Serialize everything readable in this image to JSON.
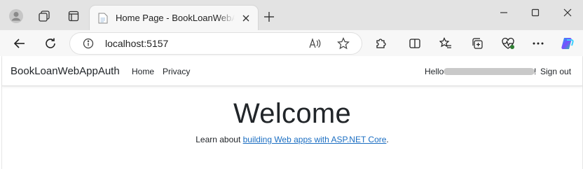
{
  "browser": {
    "tab": {
      "title": "Home Page - BookLoanWebAppAuth"
    },
    "address": {
      "url_host": "localhost",
      "url_port": ":5157"
    },
    "colors": {
      "titlebar": "#e3e3e3",
      "toolbar": "#f7f7f7",
      "link": "#1b6ec2"
    },
    "icons": {
      "profile": "profile-icon",
      "workspaces": "workspaces-icon",
      "tab_actions": "tab-actions-icon",
      "new_tab": "plus-icon",
      "back": "back-arrow-icon",
      "refresh": "refresh-icon",
      "read_aloud": "read-aloud-icon",
      "favorite": "star-icon",
      "extensions": "puzzle-icon",
      "split_screen": "split-screen-icon",
      "favorites_bar": "favorites-icon",
      "collections": "collections-icon",
      "performance": "heart-pulse-icon",
      "more": "more-icon",
      "copilot": "copilot-icon"
    }
  },
  "navbar": {
    "brand": "BookLoanWebAppAuth",
    "links": [
      "Home",
      "Privacy"
    ],
    "hello": "Hello",
    "exclaim": "!",
    "signout": "Sign out"
  },
  "main": {
    "heading": "Welcome",
    "learn_prefix": "Learn about ",
    "learn_link": "building Web apps with ASP.NET Core",
    "learn_suffix": "."
  }
}
